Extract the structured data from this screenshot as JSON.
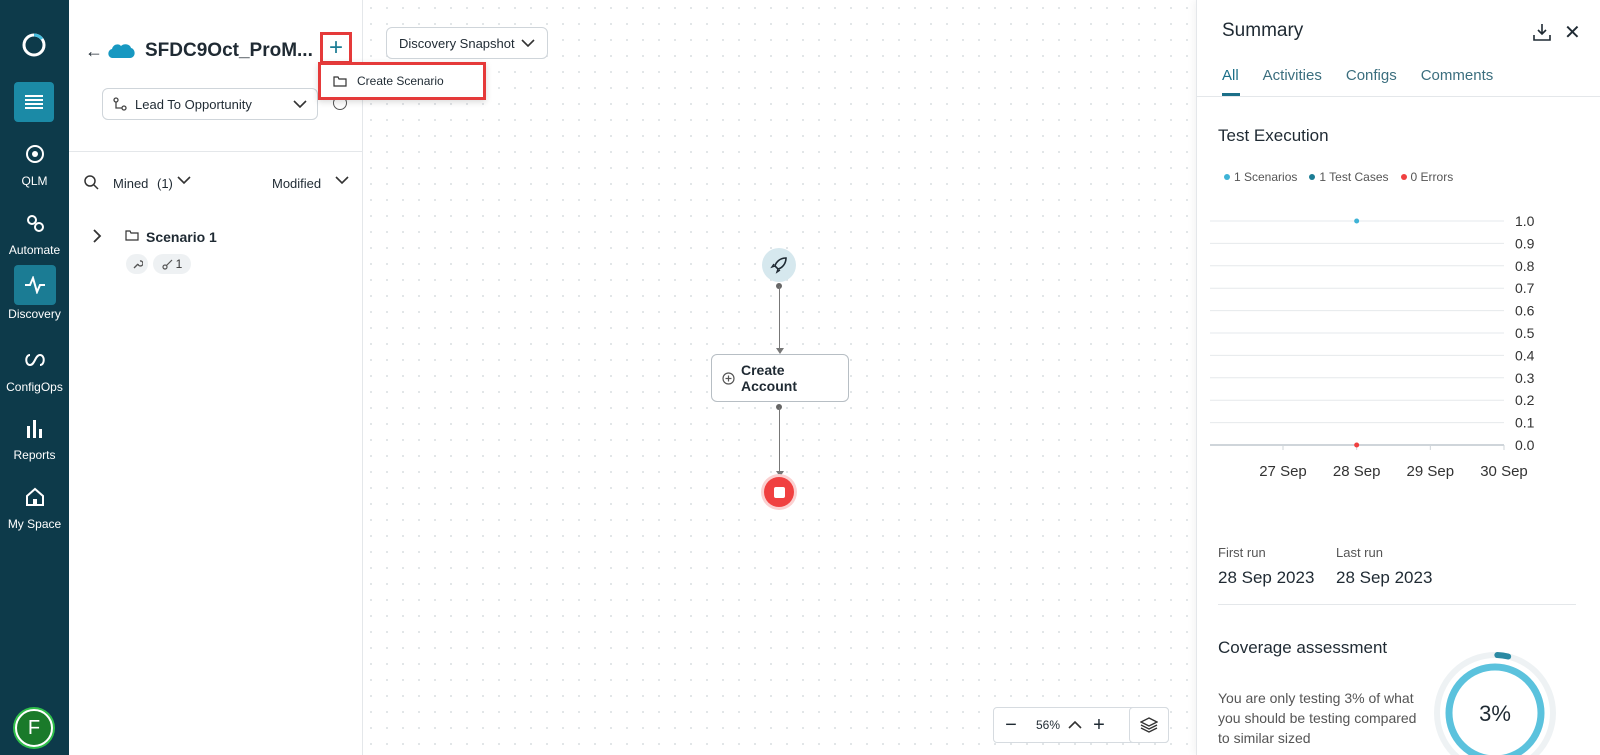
{
  "rail": {
    "items": [
      {
        "label": "QLM"
      },
      {
        "label": "Automate"
      },
      {
        "label": "Discovery"
      },
      {
        "label": "ConfigOps"
      },
      {
        "label": "Reports"
      },
      {
        "label": "My Space"
      }
    ],
    "active": "Discovery",
    "avatar": "F",
    "colors": {
      "rail_bg": "#0d3a4a",
      "accent": "#1b8aa6"
    }
  },
  "panel": {
    "project_title": "SFDC9Oct_ProM...",
    "flow_select": "Lead To Opportunity",
    "filter": {
      "mined_label": "Mined",
      "mined_count": "(1)",
      "sort_label": "Modified"
    },
    "tree": [
      {
        "name": "Scenario 1",
        "chip_count": "1"
      }
    ]
  },
  "canvas": {
    "snapshot_label": "Discovery Snapshot",
    "dropdown": {
      "item_label": "Create Scenario"
    },
    "action_node": "Create Account",
    "zoom": "56%"
  },
  "summary": {
    "title": "Summary",
    "tabs": [
      "All",
      "Activities",
      "Configs",
      "Comments"
    ],
    "active_tab": "All",
    "test_execution_title": "Test Execution",
    "legend": [
      {
        "label": "1 Scenarios",
        "color": "#3fb3d6"
      },
      {
        "label": "1 Test Cases",
        "color": "#1b7c94"
      },
      {
        "label": "0 Errors",
        "color": "#f04040"
      }
    ],
    "first_run_label": "First run",
    "first_run_value": "28 Sep 2023",
    "last_run_label": "Last run",
    "last_run_value": "28 Sep 2023",
    "coverage_title": "Coverage assessment",
    "coverage_text": "You are only testing 3% of what you should be testing compared to similar sized",
    "coverage_value": "3%",
    "coverage_fraction": 0.03
  },
  "chart_data": {
    "type": "line",
    "categories": [
      "27 Sep",
      "28 Sep",
      "29 Sep",
      "30 Sep"
    ],
    "y_ticks": [
      "1.0",
      "0.9",
      "0.8",
      "0.7",
      "0.6",
      "0.5",
      "0.4",
      "0.3",
      "0.2",
      "0.1",
      "0.0"
    ],
    "ylim": [
      0,
      1
    ],
    "series": [
      {
        "name": "1 Scenarios",
        "points": [
          {
            "x": "28 Sep",
            "y": 1.0
          }
        ],
        "color": "#3fb3d6"
      },
      {
        "name": "0 Errors",
        "points": [
          {
            "x": "28 Sep",
            "y": 0.0
          }
        ],
        "color": "#f04040"
      }
    ],
    "grid": true
  }
}
